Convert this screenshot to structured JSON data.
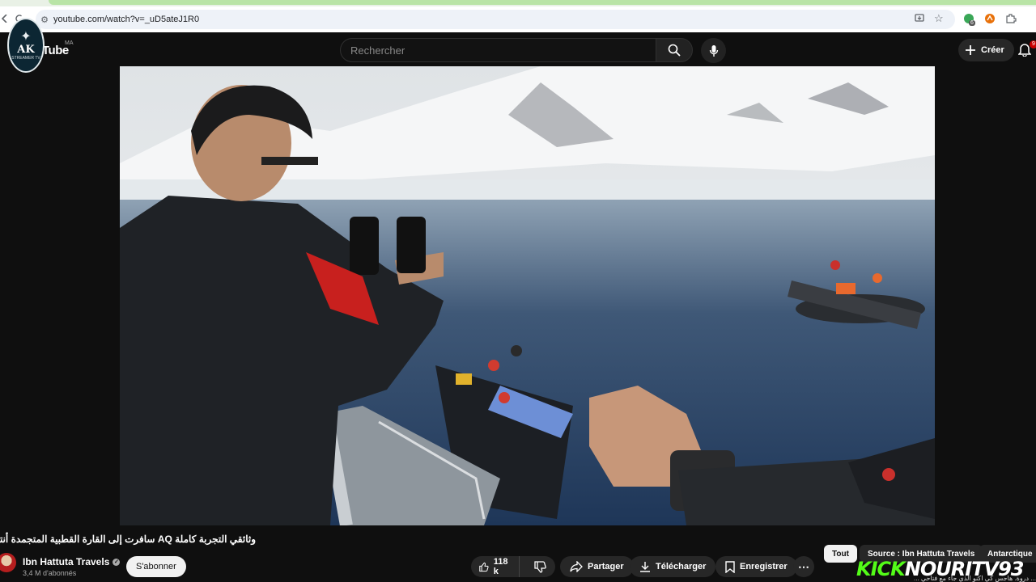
{
  "browser": {
    "url": "youtube.com/watch?v=_uD5ateJ1R0",
    "extension_badge": "6"
  },
  "header": {
    "logo_text": "AK",
    "logo_sub": "STREAMER TV",
    "brand": "Tube",
    "region": "MA",
    "search_placeholder": "Rechercher",
    "create_label": "Créer",
    "notif_count": "9"
  },
  "video": {
    "title": "وثائقي التجربة كاملة AQ سافرت إلى القارة القطبية المتجمدة أنتاركتيكا"
  },
  "channel": {
    "name": "Ibn Hattuta Travels",
    "subscribers": "3,4 M d'abonnés",
    "subscribe_label": "S'abonner"
  },
  "actions": {
    "likes": "118 k",
    "share": "Partager",
    "download": "Télécharger",
    "save": "Enregistrer",
    "more": "⋯"
  },
  "chips": [
    "Tout",
    "Source : Ibn Hattuta Travels",
    "Antarctique"
  ],
  "overlay": {
    "kick": "KICK",
    "handle": "NOURITV93",
    "ticker": "... دروة. هاجس كي اكنو الذي جاء مع فتاحي ..."
  },
  "colors": {
    "background": "#0f0f0f",
    "kick_green": "#53fc18",
    "notif_red": "#cc0000"
  }
}
